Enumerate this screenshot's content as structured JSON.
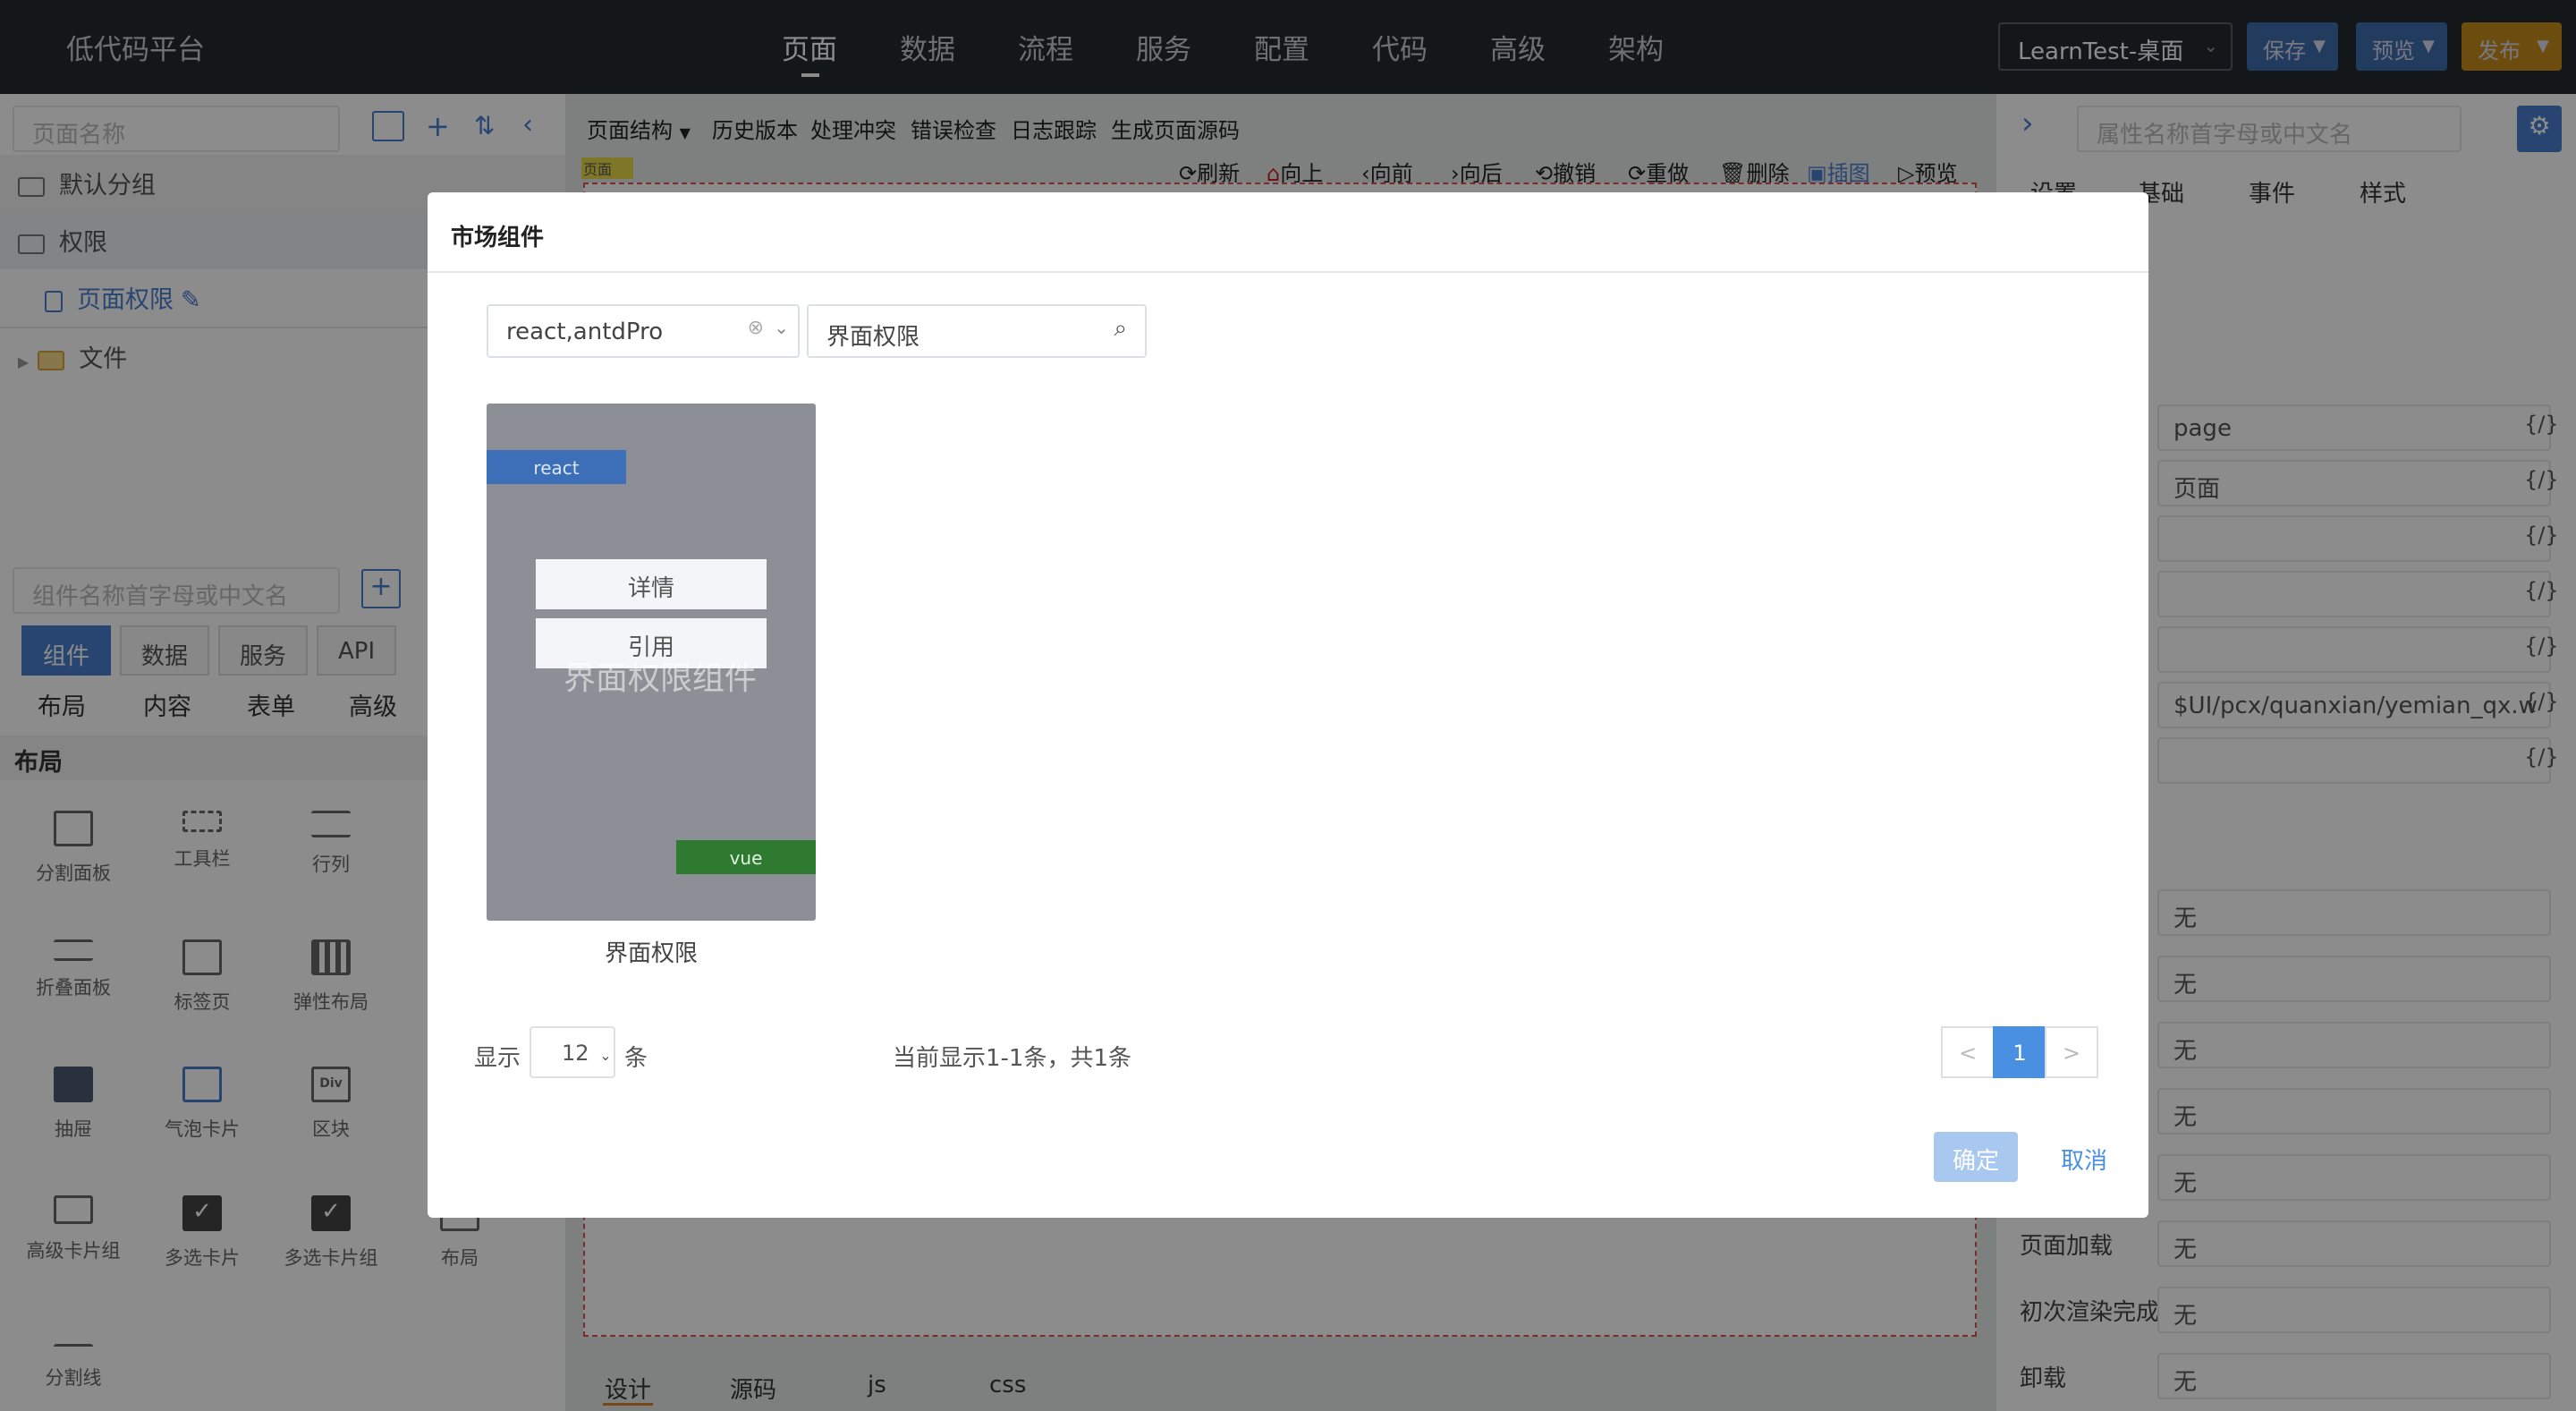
{
  "topbar": {
    "brand": "低代码平台",
    "nav": [
      "页面",
      "数据",
      "流程",
      "服务",
      "配置",
      "代码",
      "高级",
      "架构"
    ],
    "project": "LearnTest-桌面",
    "save": "保存",
    "preview": "预览",
    "publish": "发布"
  },
  "left": {
    "page_search_placeholder": "页面名称",
    "tree": [
      "默认分组",
      "权限",
      "页面权限",
      "文件"
    ],
    "comp_search_placeholder": "组件名称首字母或中文名",
    "tabs": [
      "组件",
      "数据",
      "服务",
      "API"
    ],
    "subtabs": [
      "布局",
      "内容",
      "表单",
      "高级"
    ],
    "section": "布局",
    "components": [
      "分割面板",
      "工具栏",
      "行列",
      "折叠面板",
      "标签页",
      "弹性布局",
      "抽屉",
      "气泡卡片",
      "区块",
      "高级卡片组",
      "多选卡片",
      "多选卡片组",
      "布局",
      "分割线"
    ]
  },
  "center": {
    "toolbar": [
      "页面结构",
      "历史版本",
      "处理冲突",
      "错误检查",
      "日志跟踪",
      "生成页面源码"
    ],
    "actions": [
      "刷新",
      "向上",
      "向前",
      "向后",
      "撤销",
      "重做",
      "删除",
      "插图",
      "预览"
    ],
    "page_tag": "页面",
    "bottom_tabs": [
      "设计",
      "源码",
      "js",
      "css"
    ]
  },
  "right": {
    "search_placeholder": "属性名称首字母或中文名",
    "tabs": [
      "设置",
      "基础",
      "事件",
      "样式"
    ],
    "values": [
      "page",
      "页面",
      "$UI/pcx/quanxian/yemian_qx.w"
    ],
    "none": "无",
    "labels": [
      "页面加载",
      "初次渲染完成",
      "卸载"
    ],
    "brace": "{/}"
  },
  "modal": {
    "title": "市场组件",
    "filter": "react,antdPro",
    "search": "界面权限",
    "card": {
      "react": "react",
      "vue": "vue",
      "detail": "详情",
      "use": "引用",
      "watermark": "界面权限组件",
      "label": "界面权限"
    },
    "show": "显示",
    "page_size": "12",
    "unit": "条",
    "summary": "当前显示1-1条，共1条",
    "prev": "<",
    "page": "1",
    "next": ">",
    "ok": "确定",
    "cancel": "取消"
  }
}
